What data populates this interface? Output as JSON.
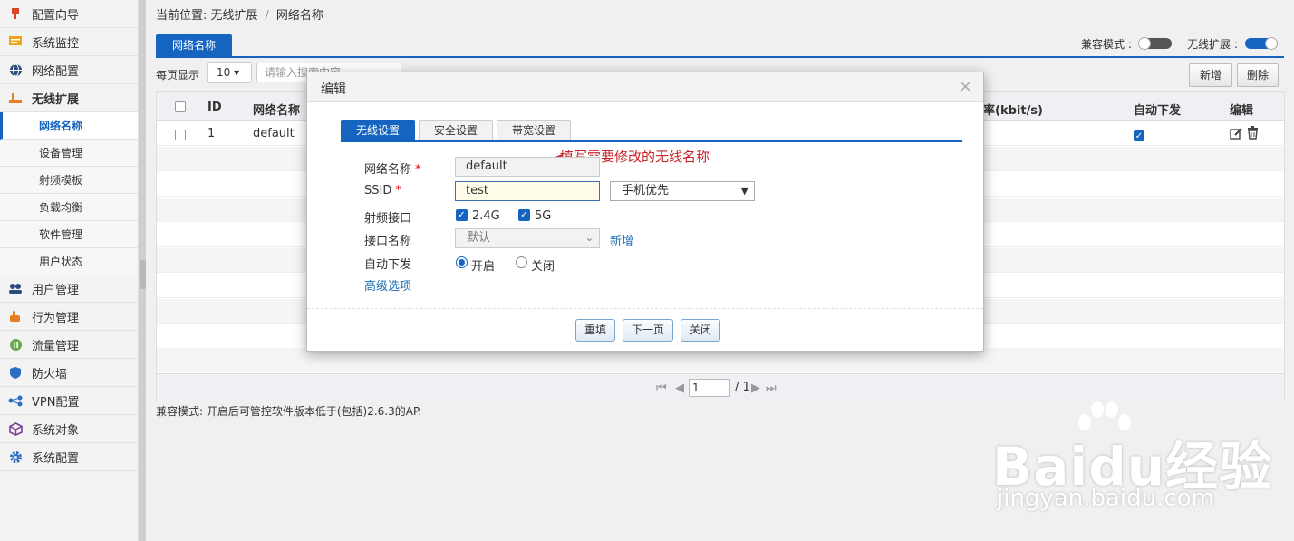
{
  "sidebar": {
    "items": [
      {
        "label": "配置向导",
        "icon": "pin-icon"
      },
      {
        "label": "系统监控",
        "icon": "monitor-icon"
      },
      {
        "label": "网络配置",
        "icon": "globe-icon"
      },
      {
        "label": "无线扩展",
        "icon": "wireless-icon"
      }
    ],
    "subitems": [
      "网络名称",
      "设备管理",
      "射频模板",
      "负载均衡",
      "软件管理",
      "用户状态"
    ],
    "items2": [
      {
        "label": "用户管理",
        "icon": "users-icon"
      },
      {
        "label": "行为管理",
        "icon": "hand-icon"
      },
      {
        "label": "流量管理",
        "icon": "traffic-icon"
      },
      {
        "label": "防火墙",
        "icon": "shield-icon"
      },
      {
        "label": "VPN配置",
        "icon": "vpn-icon"
      },
      {
        "label": "系统对象",
        "icon": "cube-icon"
      },
      {
        "label": "系统配置",
        "icon": "gear-icon"
      }
    ]
  },
  "breadcrumb": {
    "current": "当前位置: 无线扩展",
    "page": "网络名称"
  },
  "tab": {
    "label": "网络名称"
  },
  "switches": {
    "compat_label": "兼容模式 :",
    "compat_on": false,
    "ext_label": "无线扩展 :",
    "ext_on": true
  },
  "toolbar": {
    "per_page_label": "每页显示",
    "per_page_value": "10",
    "search_placeholder": "请输入搜索内容",
    "add": "新增",
    "delete": "删除"
  },
  "grid": {
    "headers": {
      "id": "ID",
      "name": "网络名称",
      "rate": "率(kbit/s)",
      "auto": "自动下发",
      "edit": "编辑"
    },
    "rows": [
      {
        "id": "1",
        "name": "default",
        "auto": true
      }
    ]
  },
  "pager": {
    "page": "1",
    "total": "/ 1"
  },
  "note": "兼容模式: 开启后可管控软件版本低于(包括)2.6.3的AP.",
  "modal": {
    "title": "编辑",
    "close": "×",
    "tabs": [
      "无线设置",
      "安全设置",
      "带宽设置"
    ],
    "annotation": "填写需要修改的无线名称",
    "fields": {
      "name_label": "网络名称",
      "name_value": "default",
      "ssid_label": "SSID",
      "ssid_value": "test",
      "ssid_select": "手机优先",
      "radio_label": "射频接口",
      "band1": "2.4G",
      "band2": "5G",
      "iface_label": "接口名称",
      "iface_value": "默认",
      "iface_add": "新增",
      "auto_label": "自动下发",
      "auto_on": "开启",
      "auto_off": "关闭",
      "advanced": "高级选项",
      "required": "*"
    },
    "buttons": {
      "reset": "重填",
      "next": "下一页",
      "close": "关闭"
    }
  },
  "watermark": {
    "logo": "Baidu经验",
    "url": "jingyan.baidu.com"
  },
  "colors": {
    "accent": "#1565c0",
    "annotation": "#c8262b"
  }
}
